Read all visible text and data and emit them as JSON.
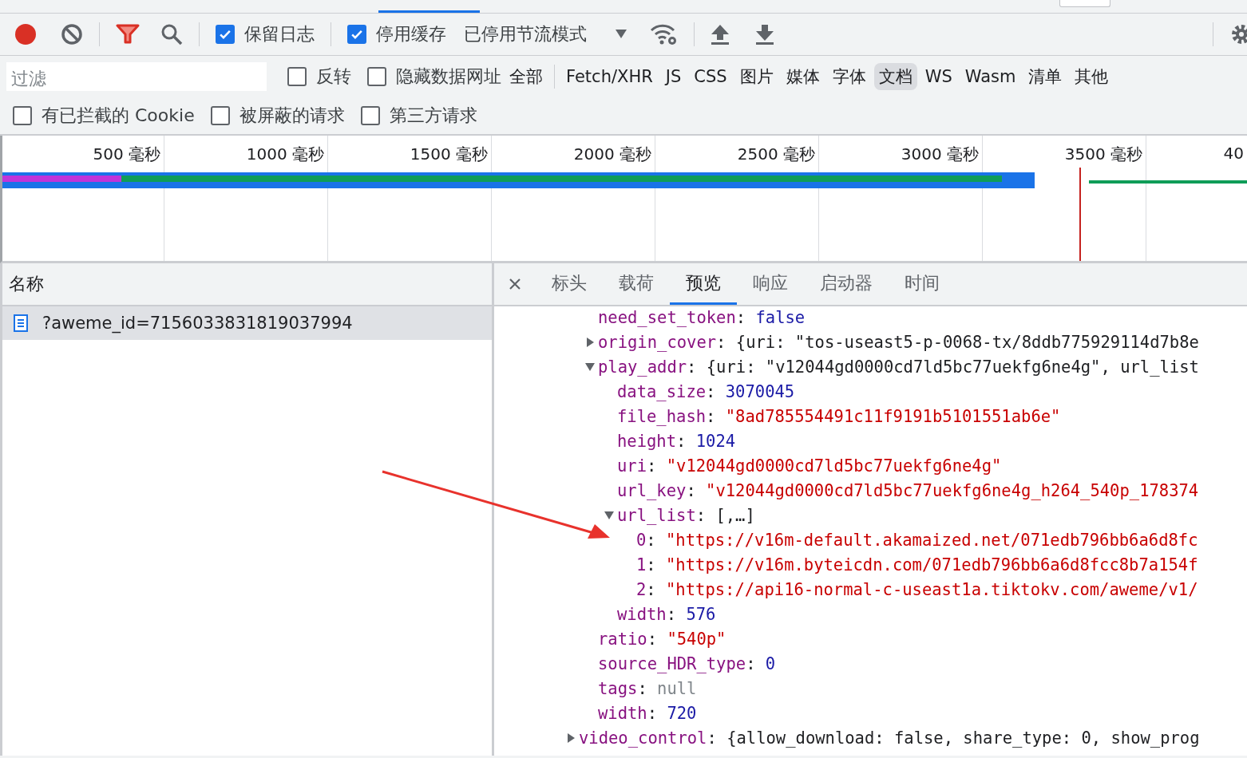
{
  "toolbar": {
    "preserve_log": {
      "label": "保留日志",
      "checked": true
    },
    "disable_cache": {
      "label": "停用缓存",
      "checked": true
    },
    "throttling": {
      "label": "已停用节流模式"
    }
  },
  "filter": {
    "placeholder": "过滤",
    "options": [
      {
        "label": "反转",
        "checked": false
      },
      {
        "label": "隐藏数据网址",
        "checked": false
      }
    ],
    "types": [
      {
        "label": "全部",
        "selected": false
      },
      {
        "label": "Fetch/XHR",
        "selected": false
      },
      {
        "label": "JS",
        "selected": false
      },
      {
        "label": "CSS",
        "selected": false
      },
      {
        "label": "图片",
        "selected": false
      },
      {
        "label": "媒体",
        "selected": false
      },
      {
        "label": "字体",
        "selected": false
      },
      {
        "label": "文档",
        "selected": true
      },
      {
        "label": "WS",
        "selected": false
      },
      {
        "label": "Wasm",
        "selected": false
      },
      {
        "label": "清单",
        "selected": false
      },
      {
        "label": "其他",
        "selected": false
      }
    ]
  },
  "extra_filters": [
    {
      "label": "有已拦截的 Cookie",
      "checked": false
    },
    {
      "label": "被屏蔽的请求",
      "checked": false
    },
    {
      "label": "第三方请求",
      "checked": false
    }
  ],
  "timeline": {
    "ticks": [
      "500 毫秒",
      "1000 毫秒",
      "1500 毫秒",
      "2000 毫秒",
      "2500 毫秒",
      "3000 毫秒",
      "3500 毫秒",
      "40"
    ]
  },
  "requests": {
    "column": "名称",
    "rows": [
      {
        "name": "?aweme_id=7156033831819037994",
        "selected": true
      }
    ]
  },
  "details": {
    "tabs": [
      {
        "label": "标头",
        "selected": false
      },
      {
        "label": "载荷",
        "selected": false
      },
      {
        "label": "预览",
        "selected": true
      },
      {
        "label": "响应",
        "selected": false
      },
      {
        "label": "启动器",
        "selected": false
      },
      {
        "label": "时间",
        "selected": false
      }
    ],
    "separator": ": ",
    "tree": [
      {
        "children": [
          {
            "key": "need_set_token",
            "value": "false",
            "kind": "bool"
          },
          {
            "key": "origin_cover",
            "value": "{uri: \"tos-useast5-p-0068-tx/8ddb775929114d7b8e",
            "kind": "object",
            "expanded": false
          },
          {
            "key": "play_addr",
            "value": "{uri: \"v12044gd0000cd7ld5bc77uekfg6ne4g\", url_list",
            "kind": "object",
            "expanded": true,
            "children": [
              {
                "key": "data_size",
                "value": "3070045",
                "kind": "number"
              },
              {
                "key": "file_hash",
                "value": "\"8ad785554491c11f9191b5101551ab6e\"",
                "kind": "string"
              },
              {
                "key": "height",
                "value": "1024",
                "kind": "number"
              },
              {
                "key": "uri",
                "value": "\"v12044gd0000cd7ld5bc77uekfg6ne4g\"",
                "kind": "string"
              },
              {
                "key": "url_key",
                "value": "\"v12044gd0000cd7ld5bc77uekfg6ne4g_h264_540p_178374",
                "kind": "string"
              },
              {
                "key": "url_list",
                "value": "[,…]",
                "kind": "object",
                "expanded": true,
                "children": [
                  {
                    "key": "0",
                    "value": "\"https://v16m-default.akamaized.net/071edb796bb6a6d8fc",
                    "kind": "string"
                  },
                  {
                    "key": "1",
                    "value": "\"https://v16m.byteicdn.com/071edb796bb6a6d8fcc8b7a154f",
                    "kind": "string"
                  },
                  {
                    "key": "2",
                    "value": "\"https://api16-normal-c-useast1a.tiktokv.com/aweme/v1/",
                    "kind": "string"
                  }
                ]
              },
              {
                "key": "width",
                "value": "576",
                "kind": "number"
              }
            ]
          },
          {
            "key": "ratio",
            "value": "\"540p\"",
            "kind": "string"
          },
          {
            "key": "source_HDR_type",
            "value": "0",
            "kind": "number"
          },
          {
            "key": "tags",
            "value": "null",
            "kind": "null"
          },
          {
            "key": "width",
            "value": "720",
            "kind": "number"
          }
        ]
      },
      {
        "key": "video_control",
        "value": "{allow_download: false, share_type: 0, show_prog",
        "kind": "object",
        "expanded": false
      }
    ]
  }
}
